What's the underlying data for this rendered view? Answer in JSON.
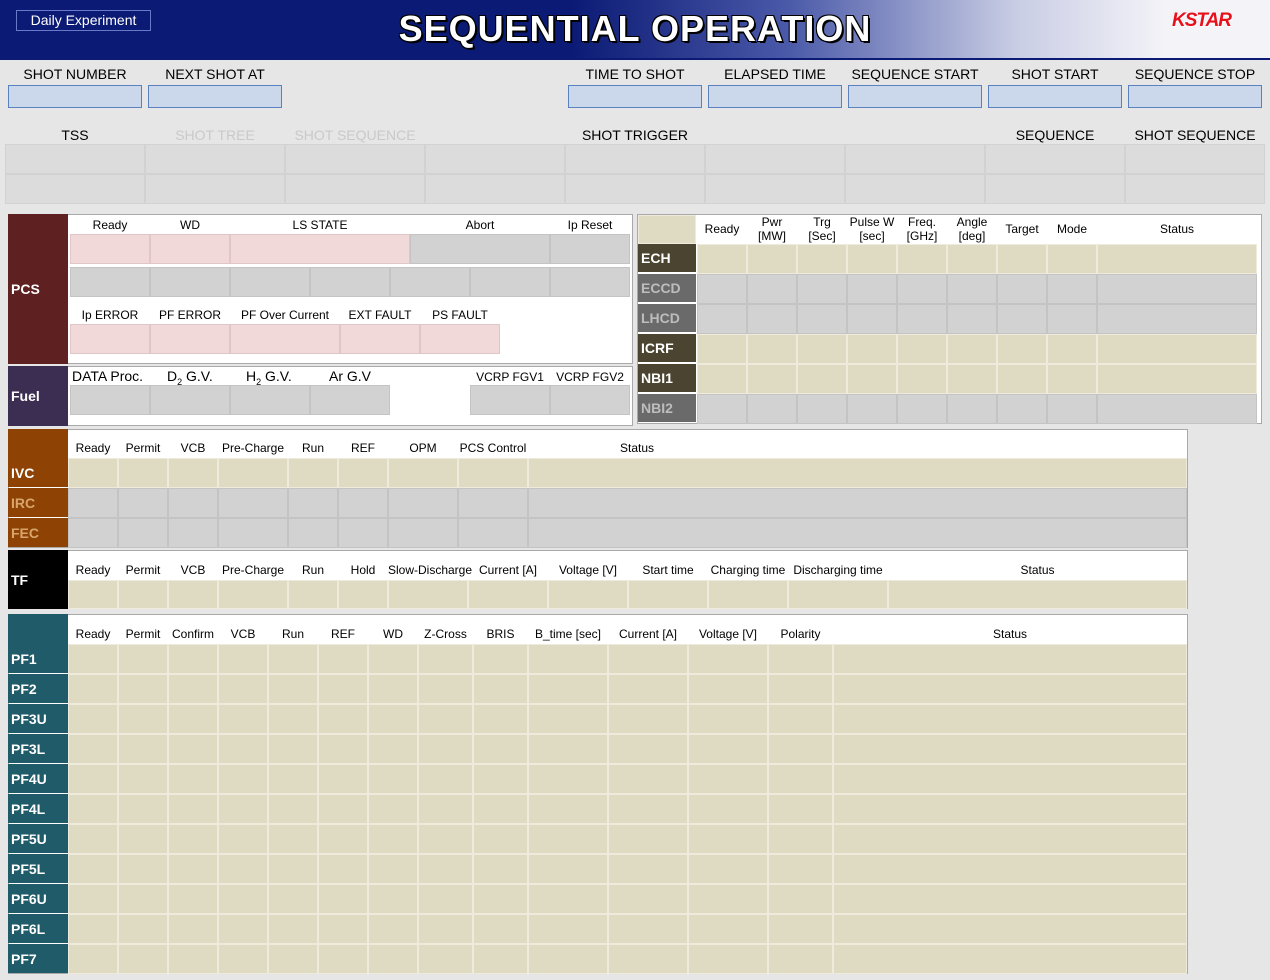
{
  "header": {
    "mode_label": "Daily Experiment",
    "title": "SEQUENTIAL OPERATION",
    "logo": "KSTAR"
  },
  "shot_info": {
    "shot_number": "SHOT NUMBER",
    "next_shot_at": "NEXT SHOT AT",
    "time_to_shot": "TIME TO SHOT",
    "elapsed_time": "ELAPSED TIME",
    "sequence_start": "SEQUENCE START",
    "shot_start": "SHOT START",
    "sequence_stop": "SEQUENCE STOP"
  },
  "trigger_row": {
    "tss": "TSS",
    "shot_tree": "SHOT TREE",
    "shot_sequence_dim": "SHOT SEQUENCE",
    "shot_trigger": "SHOT TRIGGER",
    "sequence": "SEQUENCE",
    "shot_sequence": "SHOT SEQUENCE"
  },
  "pcs": {
    "label": "PCS",
    "headers": [
      "Ready",
      "WD",
      "LS STATE",
      "Abort",
      "Ip Reset"
    ],
    "errors": [
      "Ip ERROR",
      "PF ERROR",
      "PF Over Current",
      "EXT FAULT",
      "PS FAULT"
    ]
  },
  "fuel": {
    "label": "Fuel",
    "data_proc": "DATA Proc.",
    "d2": "D",
    "d2_sub": "2",
    "d2_tail": " G.V.",
    "h2": "H",
    "h2_sub": "2",
    "h2_tail": " G.V.",
    "ar": "Ar G.V",
    "fgv1": "VCRP FGV1",
    "fgv2": "VCRP FGV2"
  },
  "heating": {
    "headers": [
      "Ready",
      "Pwr\n[MW]",
      "Trg\n[Sec]",
      "Pulse W\n[sec]",
      "Freq.\n[GHz]",
      "Angle\n[deg]",
      "Target",
      "Mode",
      "Status"
    ],
    "rows": [
      "ECH",
      "ECCD",
      "LHCD",
      "ICRF",
      "NBI1",
      "NBI2"
    ]
  },
  "ivc": {
    "headers": [
      "Ready",
      "Permit",
      "VCB",
      "Pre-Charge",
      "Run",
      "REF",
      "OPM",
      "PCS Control",
      "Status"
    ],
    "rows": [
      "IVC",
      "IRC",
      "FEC"
    ]
  },
  "tf": {
    "label": "TF",
    "headers": [
      "Ready",
      "Permit",
      "VCB",
      "Pre-Charge",
      "Run",
      "Hold",
      "Slow-Discharge",
      "Current [A]",
      "Voltage [V]",
      "Start time",
      "Charging time",
      "Discharging time",
      "Status"
    ]
  },
  "pf": {
    "headers": [
      "Ready",
      "Permit",
      "Confirm",
      "VCB",
      "Run",
      "REF",
      "WD",
      "Z-Cross",
      "BRIS",
      "B_time [sec]",
      "Current [A]",
      "Voltage [V]",
      "Polarity",
      "Status"
    ],
    "rows": [
      "PF1",
      "PF2",
      "PF3U",
      "PF3L",
      "PF4U",
      "PF4L",
      "PF5U",
      "PF5L",
      "PF6U",
      "PF6L",
      "PF7"
    ]
  },
  "colors": {
    "header": "#0b1a74",
    "pcs": "#5f2022",
    "fuel": "#3c2d52",
    "heat": "#4b4430",
    "ivc": "#8e4204",
    "pf": "#1f5b69",
    "beige": "#dfdac2"
  }
}
